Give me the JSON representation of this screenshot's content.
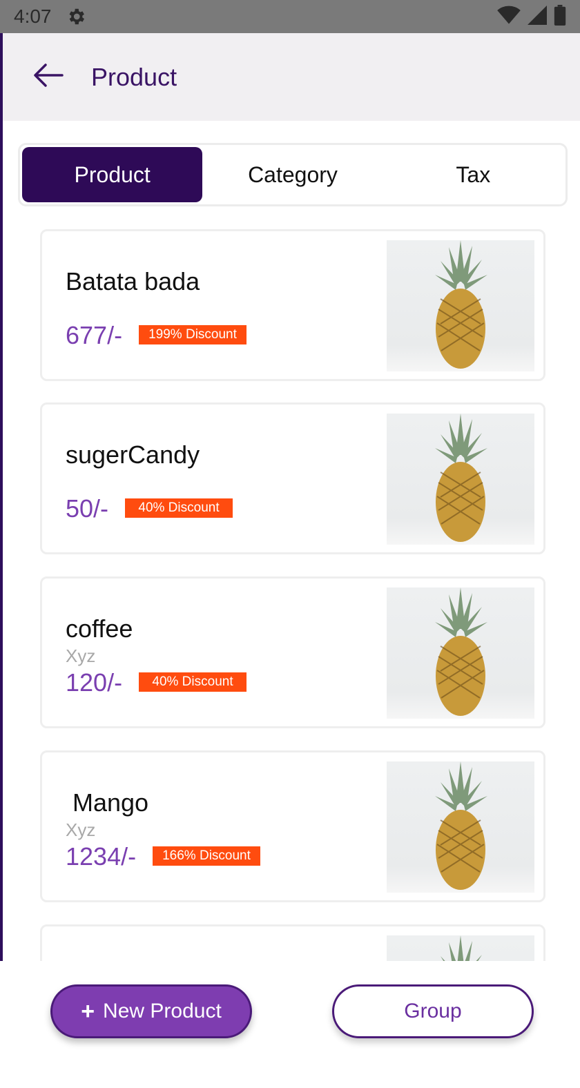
{
  "status_bar": {
    "time": "4:07",
    "icons": [
      "gear-icon",
      "wifi-icon",
      "signal-icon",
      "battery-icon"
    ]
  },
  "app_bar": {
    "title": "Product",
    "back_icon": "arrow-left-icon"
  },
  "tabs": [
    {
      "label": "Product",
      "active": true
    },
    {
      "label": "Category",
      "active": false
    },
    {
      "label": "Tax",
      "active": false
    }
  ],
  "products": [
    {
      "name": "Batata bada",
      "subtitle": "",
      "price": "677/-",
      "discount": "199% Discount"
    },
    {
      "name": "sugerCandy",
      "subtitle": "",
      "price": "50/-",
      "discount": "40% Discount"
    },
    {
      "name": "coffee",
      "subtitle": "Xyz",
      "price": "120/-",
      "discount": "40% Discount"
    },
    {
      "name": " Mango",
      "subtitle": "Xyz",
      "price": "1234/-",
      "discount": "166% Discount"
    }
  ],
  "actions": {
    "new_product_icon": "+",
    "new_product_label": "New Product",
    "group_label": "Group"
  },
  "colors": {
    "primary_dark": "#2e0a57",
    "primary": "#7e3db0",
    "price": "#7a3fb0",
    "discount_badge": "#ff4c0f"
  }
}
